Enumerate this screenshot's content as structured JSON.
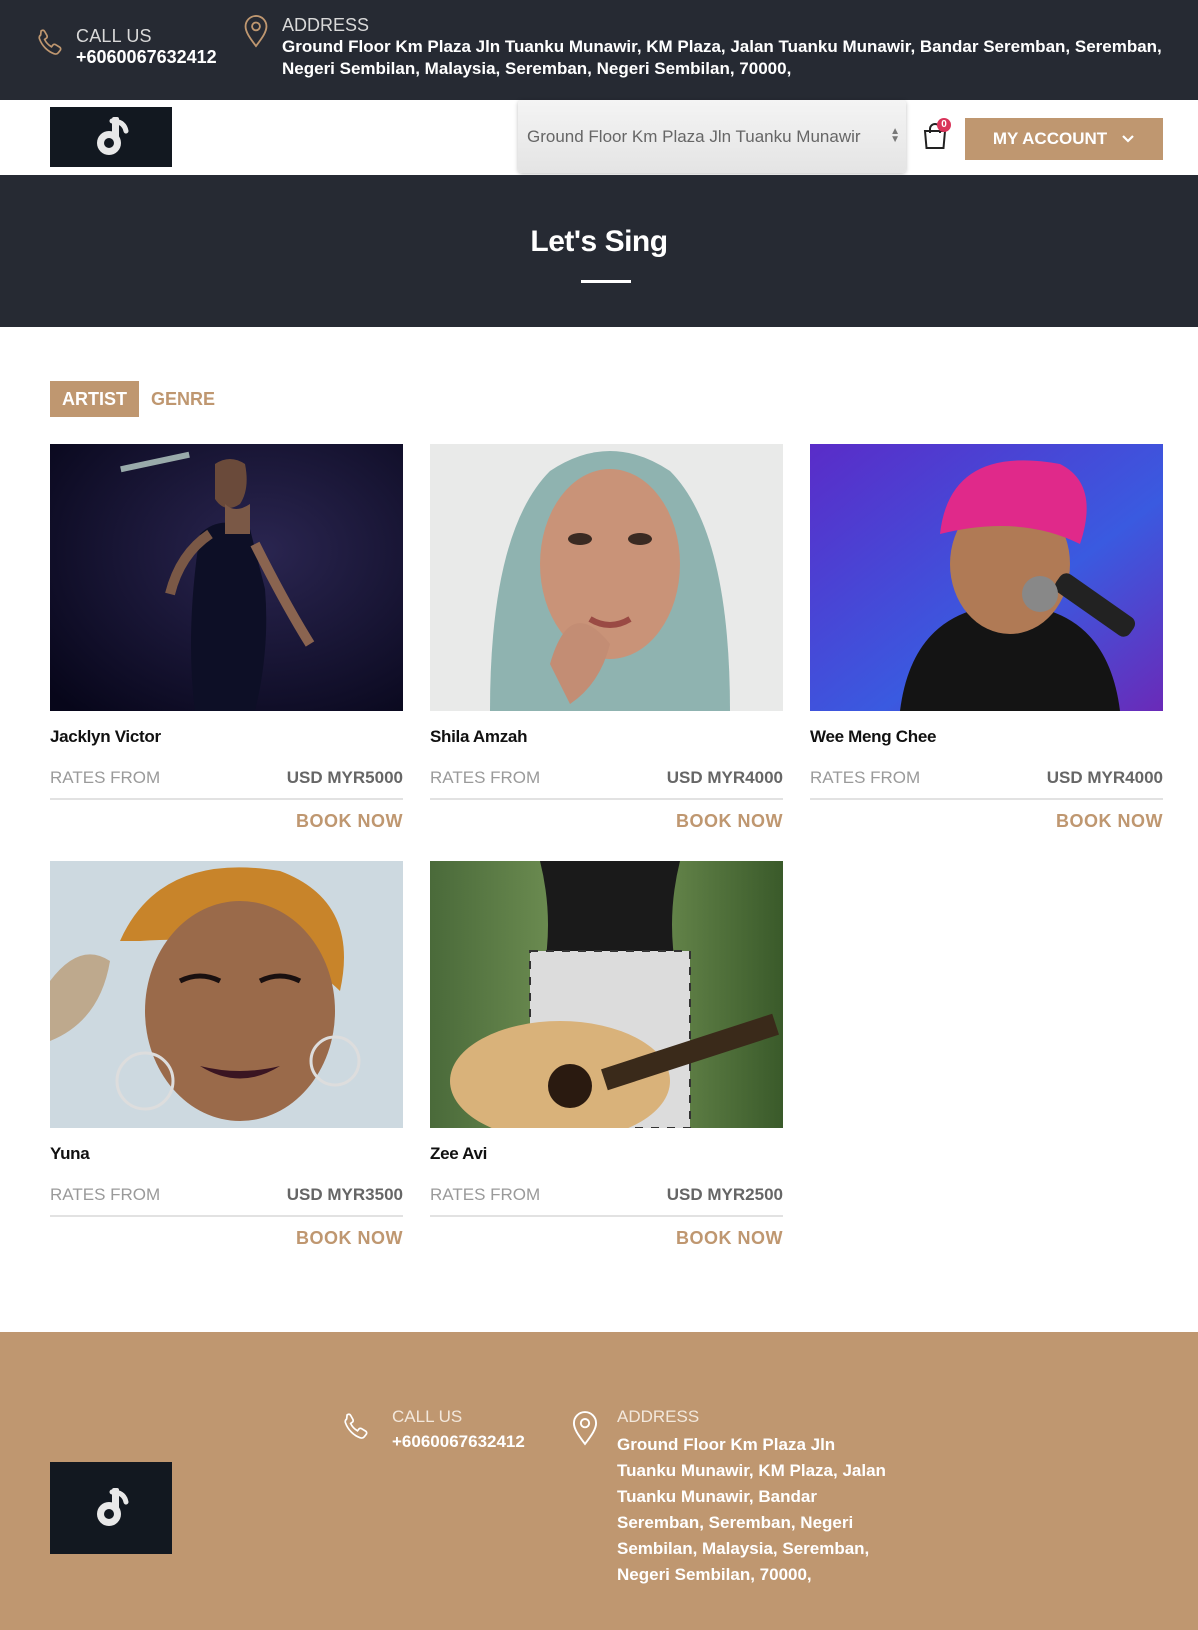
{
  "topbar": {
    "call_label": "CALL US",
    "call_value": "+6060067632412",
    "address_label": "ADDRESS",
    "address_value": "Ground Floor Km Plaza Jln Tuanku Munawir, KM Plaza, Jalan Tuanku Munawir, Bandar Seremban, Seremban, Negeri Sembilan, Malaysia, Seremban, Negeri Sembilan, 70000,"
  },
  "header": {
    "location_select_value": "Ground Floor Km Plaza Jln Tuanku Munawir",
    "cart_count": "0",
    "account_label": "MY ACCOUNT"
  },
  "hero": {
    "title": "Let's Sing"
  },
  "tabs": {
    "artist": "ARTIST",
    "genre": "GENRE"
  },
  "artists": [
    {
      "name": "Jacklyn Victor",
      "rates_label": "RATES FROM",
      "rate": "USD MYR5000",
      "book_label": "BOOK NOW"
    },
    {
      "name": "Shila Amzah",
      "rates_label": "RATES FROM",
      "rate": "USD MYR4000",
      "book_label": "BOOK NOW"
    },
    {
      "name": "Wee Meng Chee",
      "rates_label": "RATES FROM",
      "rate": "USD MYR4000",
      "book_label": "BOOK NOW"
    },
    {
      "name": "Yuna",
      "rates_label": "RATES FROM",
      "rate": "USD MYR3500",
      "book_label": "BOOK NOW"
    },
    {
      "name": "Zee Avi",
      "rates_label": "RATES FROM",
      "rate": "USD MYR2500",
      "book_label": "BOOK NOW"
    }
  ],
  "footer": {
    "call_label": "CALL US",
    "call_value": "+6060067632412",
    "address_label": "ADDRESS",
    "address_value": "Ground Floor Km Plaza Jln Tuanku Munawir, KM Plaza, Jalan Tuanku Munawir, Bandar Seremban, Seremban, Negeri Sembilan, Malaysia, Seremban, Negeri Sembilan, 70000,"
  },
  "colors": {
    "accent": "#bf9770",
    "dark": "#262a33",
    "badge": "#d9345a"
  },
  "icons": {
    "phone": "phone-icon",
    "location": "map-pin-icon",
    "cart": "shopping-bag-icon",
    "dropdown": "chevron-down-icon"
  }
}
